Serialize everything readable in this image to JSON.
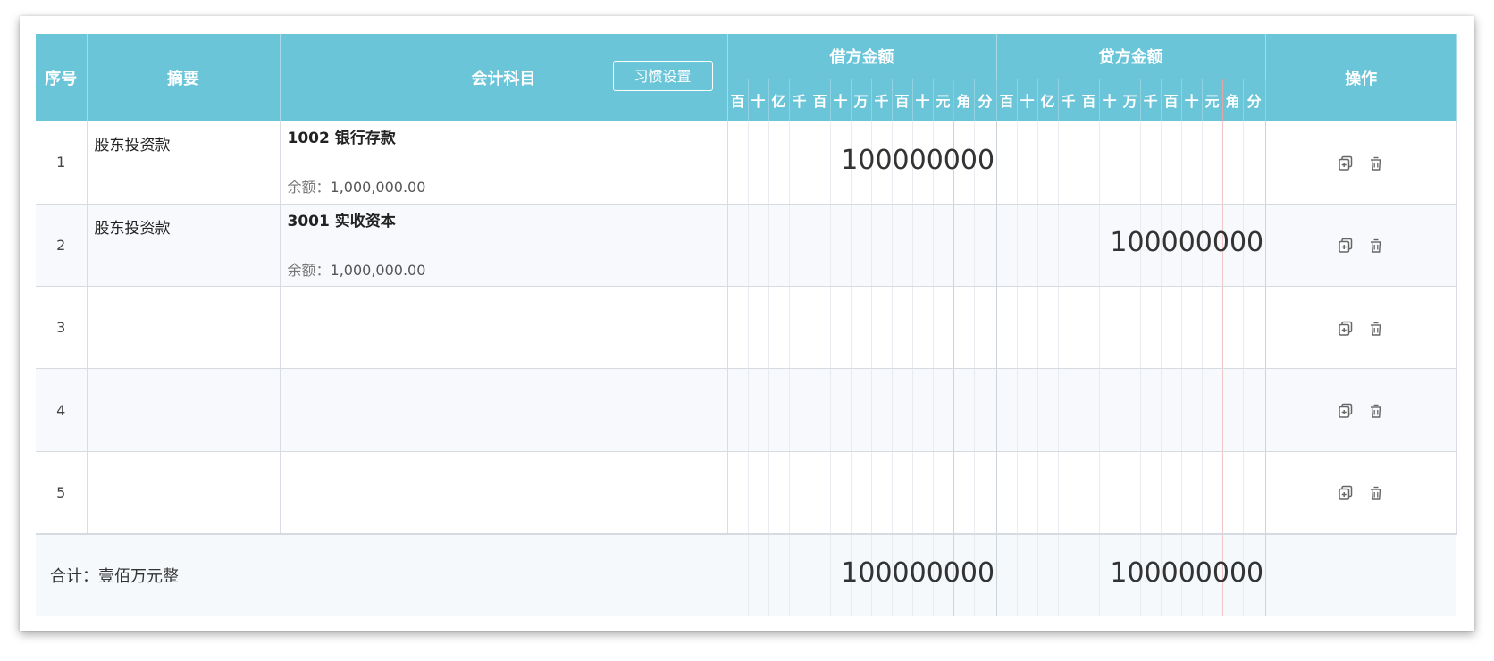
{
  "header": {
    "seq": "序号",
    "summary": "摘要",
    "account": "会计科目",
    "habit_button": "习惯设置",
    "debit": "借方金额",
    "credit": "贷方金额",
    "ops": "操作",
    "digit_units": [
      "百",
      "十",
      "亿",
      "千",
      "百",
      "十",
      "万",
      "千",
      "百",
      "十",
      "元",
      "角",
      "分"
    ]
  },
  "rows": [
    {
      "seq": "1",
      "summary": "股东投资款",
      "account": "1002 银行存款",
      "balance_label": "余额：",
      "balance": "1,000,000.00",
      "debit": "100000000",
      "credit": ""
    },
    {
      "seq": "2",
      "summary": "股东投资款",
      "account": "3001 实收资本",
      "balance_label": "余额：",
      "balance": "1,000,000.00",
      "debit": "",
      "credit": "100000000"
    },
    {
      "seq": "3",
      "summary": "",
      "account": "",
      "balance_label": "",
      "balance": "",
      "debit": "",
      "credit": ""
    },
    {
      "seq": "4",
      "summary": "",
      "account": "",
      "balance_label": "",
      "balance": "",
      "debit": "",
      "credit": ""
    },
    {
      "seq": "5",
      "summary": "",
      "account": "",
      "balance_label": "",
      "balance": "",
      "debit": "",
      "credit": ""
    }
  ],
  "total": {
    "label": "合计：壹佰万元整",
    "debit": "100000000",
    "credit": "100000000"
  },
  "icons": {
    "copy": "copy-icon",
    "delete": "trash-icon"
  },
  "colors": {
    "header_bg": "#6bc5d9",
    "yuan_line": "#e6a5a5"
  }
}
